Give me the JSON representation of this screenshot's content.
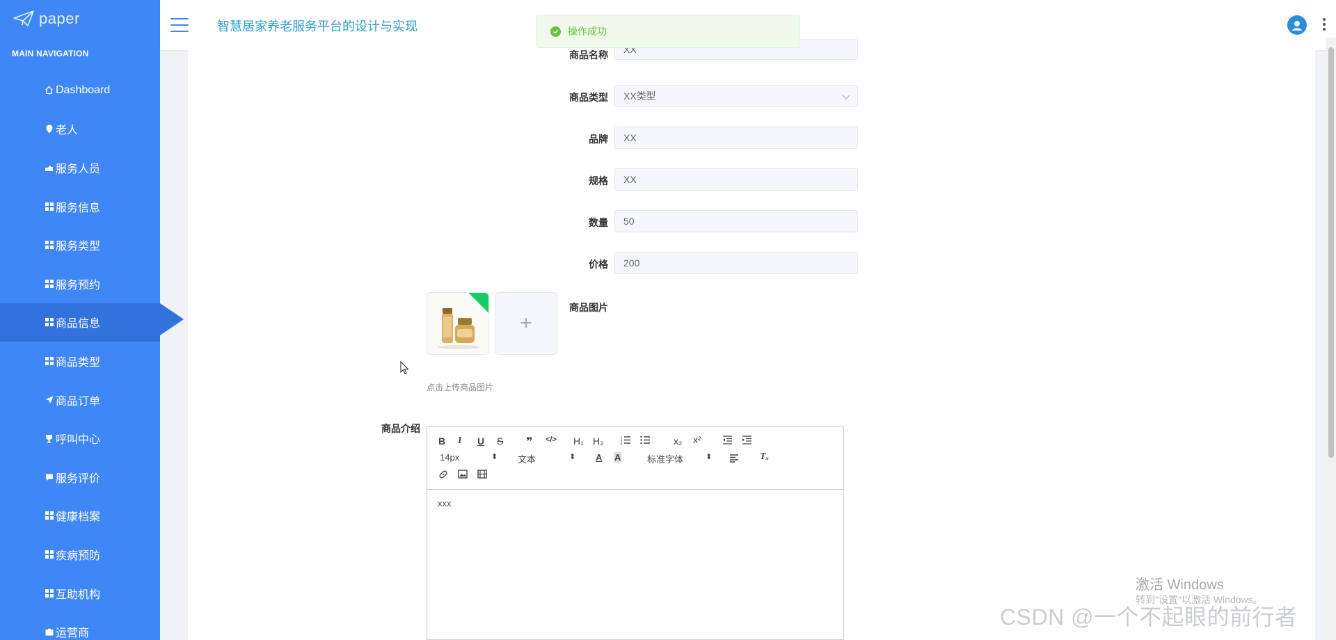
{
  "sidebar": {
    "brand": "paper",
    "nav_title": "MAIN NAVIGATION",
    "items": [
      {
        "label": "Dashboard",
        "icon": "home-icon"
      },
      {
        "label": "老人",
        "icon": "map-pin-icon"
      },
      {
        "label": "服务人员",
        "icon": "hand-icon"
      },
      {
        "label": "服务信息",
        "icon": "grid-icon"
      },
      {
        "label": "服务类型",
        "icon": "grid-icon"
      },
      {
        "label": "服务预约",
        "icon": "grid-icon"
      },
      {
        "label": "商品信息",
        "icon": "grid-icon",
        "active": true
      },
      {
        "label": "商品类型",
        "icon": "grid-icon"
      },
      {
        "label": "商品订单",
        "icon": "send-icon"
      },
      {
        "label": "呼叫中心",
        "icon": "trophy-icon"
      },
      {
        "label": "服务评价",
        "icon": "comment-icon"
      },
      {
        "label": "健康档案",
        "icon": "grid-icon"
      },
      {
        "label": "疾病预防",
        "icon": "grid-icon"
      },
      {
        "label": "互助机构",
        "icon": "grid-icon"
      },
      {
        "label": "运营商",
        "icon": "briefcase-icon"
      }
    ]
  },
  "header": {
    "title": "智慧居家养老服务平台的设计与实现"
  },
  "toast": {
    "message": "操作成功"
  },
  "form": {
    "name_label": "商品名称",
    "name_value": "XX",
    "type_label": "商品类型",
    "type_value": "XX类型",
    "brand_label": "品牌",
    "brand_value": "XX",
    "spec_label": "规格",
    "spec_value": "XX",
    "qty_label": "数量",
    "qty_value": "50",
    "price_label": "价格",
    "price_value": "200",
    "image_label": "商品图片",
    "image_hint": "点击上传商品图片",
    "intro_label": "商品介绍"
  },
  "editor": {
    "font_size": "14px",
    "text_style": "文本",
    "font_family": "标准字体",
    "content": "xxx",
    "btn_bold": "B",
    "btn_italic": "I",
    "btn_underline": "U",
    "btn_strike": "S",
    "btn_quote": "❞",
    "btn_code": "</>",
    "btn_h1": "H₁",
    "btn_h2": "H₂",
    "btn_sub": "x₂",
    "btn_sup": "x²",
    "btn_clear": "Tₓ"
  },
  "watermark": {
    "line1": "激活 Windows",
    "line2": "转到\"设置\"以激活 Windows。",
    "csdn": "CSDN @一个不起眼的前行者"
  },
  "colors": {
    "sidebar": "#3f86f6",
    "sidebar_active": "#3272dc",
    "title": "#2fa0c8",
    "success": "#67c23a"
  }
}
